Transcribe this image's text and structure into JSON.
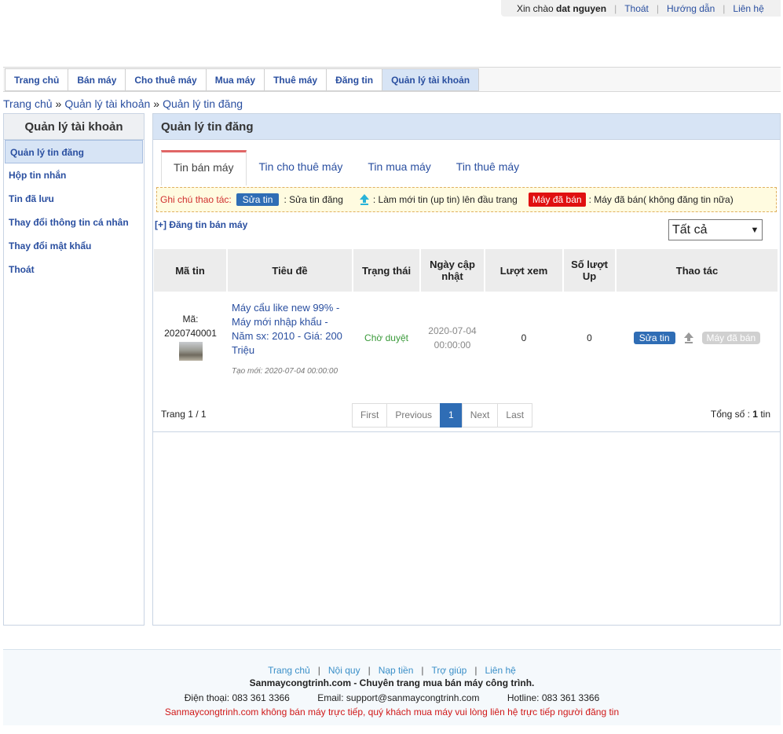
{
  "topbar": {
    "greeting": "Xin chào",
    "username": "dat nguyen",
    "logout": "Thoát",
    "guide": "Hướng dẫn",
    "contact": "Liên hệ"
  },
  "nav": {
    "items": [
      "Trang chủ",
      "Bán máy",
      "Cho thuê máy",
      "Mua máy",
      "Thuê máy",
      "Đăng tin",
      "Quản lý tài khoản"
    ],
    "active_index": 6
  },
  "breadcrumb": [
    "Trang chủ",
    "Quản lý tài khoản",
    "Quản lý tin đăng"
  ],
  "breadcrumb_sep": "»",
  "sidebar": {
    "title": "Quản lý tài khoản",
    "items": [
      "Quản lý tin đăng",
      "Hộp tin nhắn",
      "Tin đã lưu",
      "Thay đổi thông tin cá nhân",
      "Thay đổi mật khẩu",
      "Thoát"
    ]
  },
  "main": {
    "title": "Quản lý tin đăng",
    "tabs": [
      "Tin bán máy",
      "Tin cho thuê máy",
      "Tin mua máy",
      "Tin thuê máy"
    ],
    "note": {
      "label": "Ghi chú thao tác:",
      "edit_badge": "Sửa tin",
      "edit_text": ": Sửa tin đăng",
      "up_text": ": Làm mới tin (up tin) lên đầu trang",
      "sold_badge": "Máy đã bán",
      "sold_text": ": Máy đã bán( không đăng tin nữa)"
    },
    "add_link": "[+] Đăng tin bán máy",
    "filter_value": "Tất cả",
    "columns": [
      "Mã tin",
      "Tiêu đề",
      "Trạng thái",
      "Ngày cập nhật",
      "Lượt xem",
      "Số lượt Up",
      "Thao tác"
    ],
    "rows": [
      {
        "code_label": "Mã:",
        "code": "2020740001",
        "title": "Máy cẩu like new 99% - Máy mới nhập khẩu - Năm sx: 2010 - Giá: 200 Triệu",
        "created": "Tạo mới: 2020-07-04 00:00:00",
        "status": "Chờ duyệt",
        "updated": "2020-07-04 00:00:00",
        "views": "0",
        "ups": "0",
        "edit_label": "Sửa tin",
        "sold_label": "Máy đã bán"
      }
    ],
    "pager": {
      "page_label": "Trang 1 / 1",
      "buttons": [
        "First",
        "Previous",
        "1",
        "Next",
        "Last"
      ],
      "current": "1",
      "total_prefix": "Tổng số :",
      "total_count": "1",
      "total_suffix": "tin"
    }
  },
  "footer": {
    "links": [
      "Trang chủ",
      "Nội quy",
      "Nạp tiền",
      "Trợ giúp",
      "Liên hệ"
    ],
    "tagline": "Sanmaycongtrinh.com - Chuyên trang mua bán máy công trình.",
    "phone": "Điện thoại: 083 361 3366",
    "email": "Email: support@sanmaycongtrinh.com",
    "hotline": "Hotline: 083 361 3366",
    "warning": "Sanmaycongtrinh.com không bán máy trực tiếp, quý khách mua máy vui lòng liên hệ trực tiếp người đăng tin"
  },
  "colors": {
    "link": "#2a4fa0",
    "accent_blue": "#2f6db5",
    "sold_red": "#e01010",
    "status_green": "#3a9a3a",
    "active_bg": "#d7e4f5"
  }
}
